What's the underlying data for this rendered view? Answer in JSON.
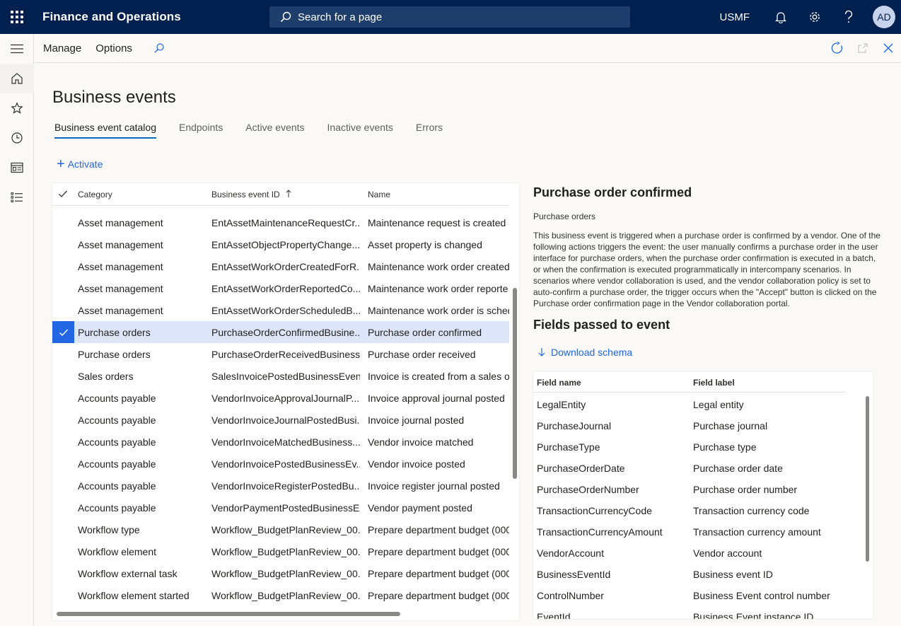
{
  "header": {
    "app_title": "Finance and Operations",
    "search_placeholder": "Search for a page",
    "company": "USMF",
    "avatar_initials": "AD"
  },
  "actionbar": {
    "manage": "Manage",
    "options": "Options"
  },
  "page": {
    "title": "Business events",
    "tabs": [
      "Business event catalog",
      "Endpoints",
      "Active events",
      "Inactive events",
      "Errors"
    ],
    "active_tab": "Business event catalog",
    "activate_label": "Activate"
  },
  "grid": {
    "headers": {
      "category": "Category",
      "id": "Business event ID",
      "name": "Name"
    },
    "rows": [
      {
        "category": "Asset management",
        "id": "EntAssetMaintenanceRequestCr...",
        "name": "Maintenance request is created"
      },
      {
        "category": "Asset management",
        "id": "EntAssetObjectPropertyChange...",
        "name": "Asset property is changed"
      },
      {
        "category": "Asset management",
        "id": "EntAssetWorkOrderCreatedForR...",
        "name": "Maintenance work order created"
      },
      {
        "category": "Asset management",
        "id": "EntAssetWorkOrderReportedCo...",
        "name": "Maintenance work order reporte"
      },
      {
        "category": "Asset management",
        "id": "EntAssetWorkOrderScheduledB...",
        "name": "Maintenance work order is sched"
      },
      {
        "category": "Purchase orders",
        "id": "PurchaseOrderConfirmedBusine...",
        "name": "Purchase order confirmed",
        "selected": true
      },
      {
        "category": "Purchase orders",
        "id": "PurchaseOrderReceivedBusiness...",
        "name": "Purchase order received"
      },
      {
        "category": "Sales orders",
        "id": "SalesInvoicePostedBusinessEvent",
        "name": "Invoice is created from a sales or"
      },
      {
        "category": "Accounts payable",
        "id": "VendorInvoiceApprovalJournalP...",
        "name": "Invoice approval journal posted"
      },
      {
        "category": "Accounts payable",
        "id": "VendorInvoiceJournalPostedBusi...",
        "name": "Invoice journal posted"
      },
      {
        "category": "Accounts payable",
        "id": "VendorInvoiceMatchedBusiness...",
        "name": "Vendor invoice matched"
      },
      {
        "category": "Accounts payable",
        "id": "VendorInvoicePostedBusinessEv...",
        "name": "Vendor invoice posted"
      },
      {
        "category": "Accounts payable",
        "id": "VendorInvoiceRegisterPostedBu...",
        "name": "Invoice register journal posted"
      },
      {
        "category": "Accounts payable",
        "id": "VendorPaymentPostedBusinessE...",
        "name": "Vendor payment posted"
      },
      {
        "category": "Workflow type",
        "id": "Workflow_BudgetPlanReview_00...",
        "name": "Prepare department budget (000"
      },
      {
        "category": "Workflow element",
        "id": "Workflow_BudgetPlanReview_00...",
        "name": "Prepare department budget (000"
      },
      {
        "category": "Workflow external task",
        "id": "Workflow_BudgetPlanReview_00...",
        "name": "Prepare department budget (000"
      },
      {
        "category": "Workflow element started",
        "id": "Workflow_BudgetPlanReview_00...",
        "name": "Prepare department budget (000"
      }
    ]
  },
  "detail": {
    "title": "Purchase order confirmed",
    "category": "Purchase orders",
    "description": "This business event is triggered when a purchase order is confirmed by a vendor. One of the following actions triggers the event: the user manually confirms a purchase order in the user interface for purchase orders, when the purchase order confirmation is executed in a batch, or when the confirmation is executed programmatically in intercompany scenarios. In scenarios where vendor collaboration is used, and the vendor collaboration policy is set to auto-confirm a purchase order, the trigger occurs when the \"Accept\" button is clicked on the Purchase order confirmation page in the Vendor collaboration portal.",
    "fields_title": "Fields passed to event",
    "download_label": "Download schema",
    "fields_headers": {
      "name": "Field name",
      "label": "Field label"
    },
    "fields": [
      {
        "name": "LegalEntity",
        "label": "Legal entity"
      },
      {
        "name": "PurchaseJournal",
        "label": "Purchase journal"
      },
      {
        "name": "PurchaseType",
        "label": "Purchase type"
      },
      {
        "name": "PurchaseOrderDate",
        "label": "Purchase order date"
      },
      {
        "name": "PurchaseOrderNumber",
        "label": "Purchase order number"
      },
      {
        "name": "TransactionCurrencyCode",
        "label": "Transaction currency code"
      },
      {
        "name": "TransactionCurrencyAmount",
        "label": "Transaction currency amount"
      },
      {
        "name": "VendorAccount",
        "label": "Vendor account"
      },
      {
        "name": "BusinessEventId",
        "label": "Business event ID"
      },
      {
        "name": "ControlNumber",
        "label": "Business Event control number"
      },
      {
        "name": "EventId",
        "label": "Business Event instance ID"
      }
    ]
  },
  "colors": {
    "topbar": "#002050",
    "accent": "#2266e3",
    "selected_row": "#dde6f8"
  },
  "icons": {
    "waffle": "app-launcher-icon",
    "search": "search-icon",
    "bell": "bell-icon",
    "gear": "gear-icon",
    "help": "help-icon",
    "refresh": "refresh-icon",
    "open": "open-in-new-icon",
    "close": "close-icon"
  }
}
